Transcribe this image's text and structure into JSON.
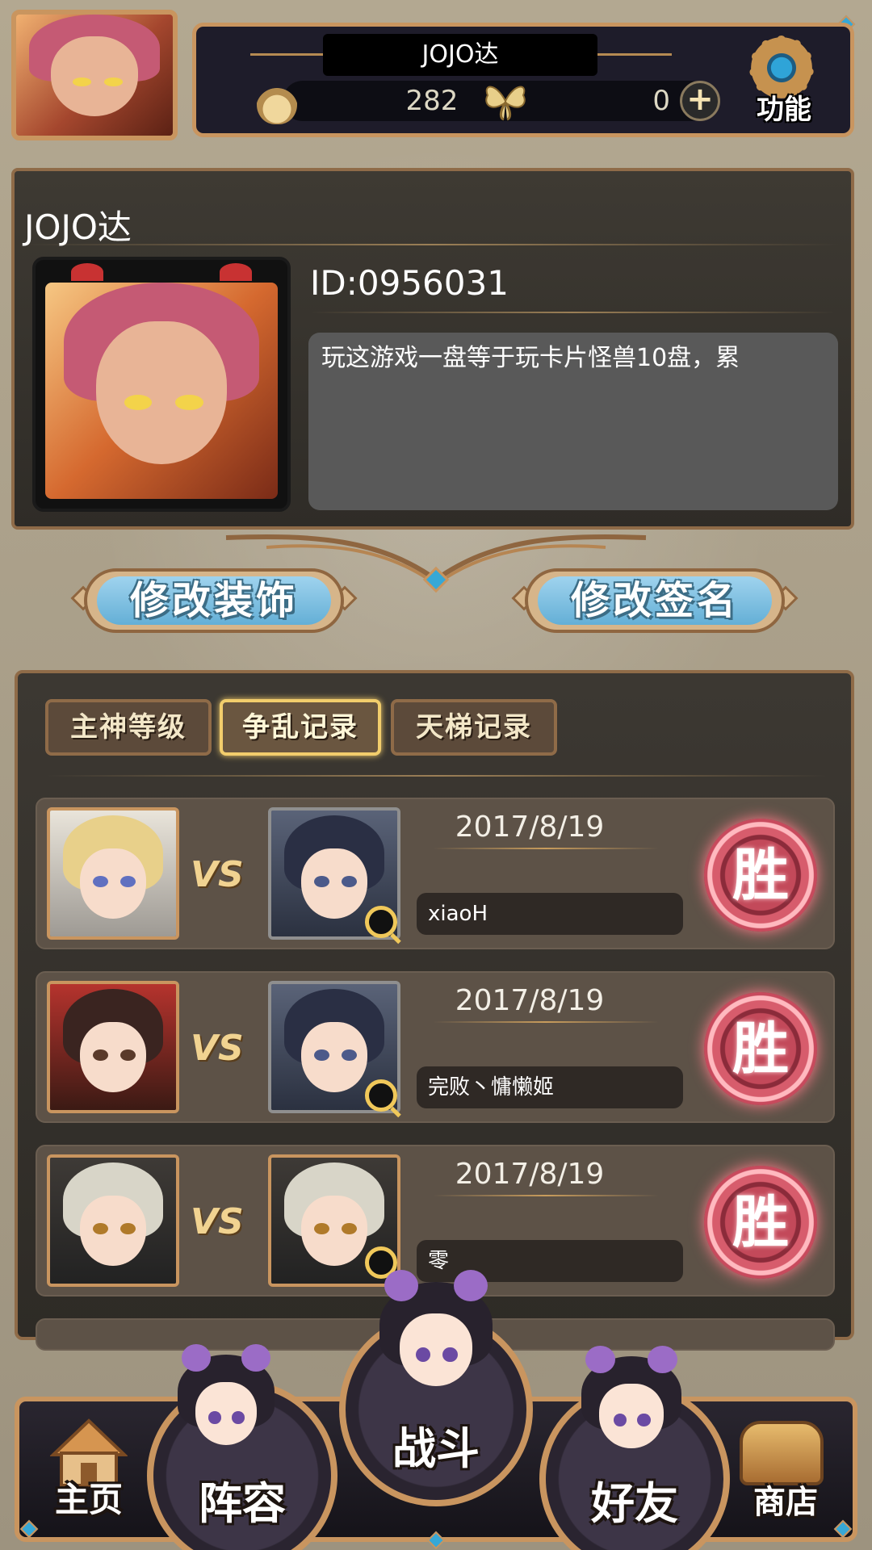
{
  "header": {
    "player_name": "JOJO达",
    "flame_count": "282",
    "butterfly_count": "0",
    "plus_symbol": "+",
    "function_label": "功能"
  },
  "profile": {
    "name": "JOJO达",
    "id_text": "ID:0956031",
    "signature": "玩这游戏一盘等于玩卡片怪兽10盘，累"
  },
  "actions": {
    "edit_decoration": "修改装饰",
    "edit_signature": "修改签名"
  },
  "tabs": [
    {
      "label": "主神等级",
      "active": false
    },
    {
      "label": "争乱记录",
      "active": true
    },
    {
      "label": "天梯记录",
      "active": false
    }
  ],
  "records": [
    {
      "date": "2017/8/19",
      "opponent": "xiaoH",
      "vs": "VS",
      "result": "胜"
    },
    {
      "date": "2017/8/19",
      "opponent": "完败丶慵懒姬",
      "vs": "VS",
      "result": "胜"
    },
    {
      "date": "2017/8/19",
      "opponent": "零",
      "vs": "VS",
      "result": "胜"
    }
  ],
  "nav": {
    "home": "主页",
    "lineup": "阵容",
    "battle": "战斗",
    "friends": "好友",
    "shop": "商店"
  },
  "colors": {
    "frame_gold": "#c9955f",
    "panel_dark": "#2f2c27",
    "button_blue": "#64afd6",
    "win_red": "#c84a5d"
  }
}
